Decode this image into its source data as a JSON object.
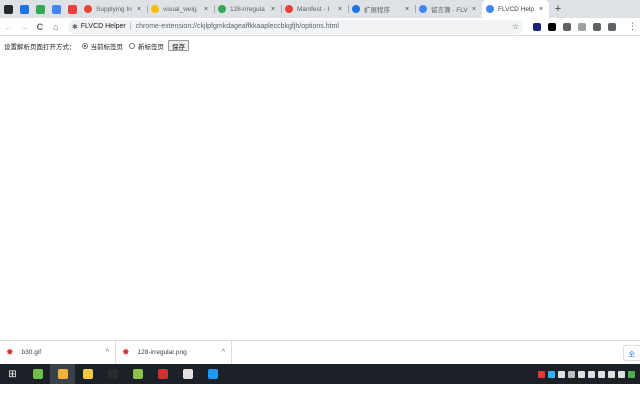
{
  "tabs": {
    "pinned": [
      {
        "name": "github",
        "color": "#24292e"
      },
      {
        "name": "tab-icon-blue",
        "color": "#1a73e8"
      },
      {
        "name": "tab-icon-green",
        "color": "#34a853"
      },
      {
        "name": "tab-icon-lightblue",
        "color": "#4285f4"
      },
      {
        "name": "tab-icon-red",
        "color": "#ea4335"
      }
    ],
    "items": [
      {
        "title": "Supplying In",
        "fav": "#ea4335"
      },
      {
        "title": "visual_weig",
        "fav": "#fbbc05"
      },
      {
        "title": "128-irregula",
        "fav": "#34a853"
      },
      {
        "title": "Manifest - I",
        "fav": "#ea4335"
      },
      {
        "title": "扩展程序",
        "fav": "#1a73e8"
      },
      {
        "title": "留言簿 - FLV",
        "fav": "#4285f4"
      },
      {
        "title": "FLVCD Help",
        "fav": "#4285f4",
        "active": true
      }
    ],
    "new_tab": "+"
  },
  "toolbar": {
    "back": "←",
    "forward": "→",
    "reload": "C",
    "home": "⌂",
    "site_name": "FLVCD Helper",
    "separator": "|",
    "url": "chrome-extension://ckjlpfgmkdageaffkkaapleccbkgfjh/options.html",
    "star": "☆",
    "menu": "⋮"
  },
  "extensions": [
    {
      "name": "ext-1",
      "color": "#1a237e"
    },
    {
      "name": "ext-2",
      "color": "#000000"
    },
    {
      "name": "ext-3",
      "color": "#5f6368"
    },
    {
      "name": "ext-4",
      "color": "#9aa0a6"
    },
    {
      "name": "ext-5",
      "color": "#5f6368"
    },
    {
      "name": "ext-6",
      "color": "#5f6368"
    }
  ],
  "options": {
    "label": "设置解析页面打开方式：",
    "radio_current": "当前标签页",
    "radio_new": "新标签页",
    "save": "保存"
  },
  "downloads": [
    {
      "file": "b30.gif",
      "caret": "^"
    },
    {
      "file": "128-irregular.png",
      "caret": "^"
    }
  ],
  "show_all": "全",
  "taskbar": {
    "start": "⊞",
    "apps": [
      {
        "name": "app-1",
        "color": "#6fbf4a"
      },
      {
        "name": "app-2",
        "color": "#f2b134",
        "active": true
      },
      {
        "name": "app-3",
        "color": "#f6c744"
      },
      {
        "name": "app-4",
        "color": "#2b2b2b"
      },
      {
        "name": "app-5",
        "color": "#8bc34a"
      },
      {
        "name": "app-6",
        "color": "#d32f2f"
      },
      {
        "name": "app-7",
        "color": "#e0e0e0"
      },
      {
        "name": "app-8",
        "color": "#2196f3"
      }
    ],
    "tray": [
      "#e53935",
      "#29b6f6",
      "#e0e0e0",
      "#bdbdbd",
      "#e0e0e0",
      "#e0e0e0",
      "#e0e0e0",
      "#e0e0e0",
      "#e0e0e0",
      "#4caf50"
    ]
  }
}
